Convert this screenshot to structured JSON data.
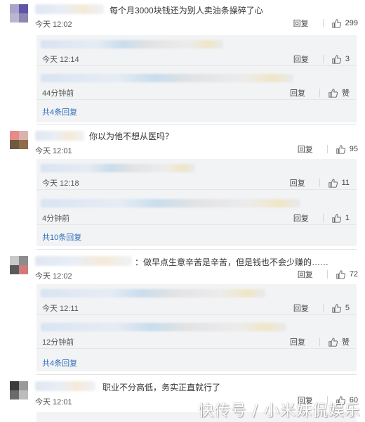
{
  "comments": [
    {
      "text": "每个月3000块钱还为别人卖油条操碎了心",
      "time": "今天 12:02",
      "reply_label": "回复",
      "likes": "299",
      "replies": [
        {
          "time": "今天 12:14",
          "reply_label": "回复",
          "likes": "3"
        },
        {
          "time": "44分钟前",
          "reply_label": "回复",
          "likes": "赞"
        }
      ],
      "more_label": "共4条回复"
    },
    {
      "text": "你以为他不想从医吗？",
      "time": "今天 12:01",
      "reply_label": "回复",
      "likes": "95",
      "replies": [
        {
          "time": "今天 12:18",
          "reply_label": "回复",
          "likes": "11"
        },
        {
          "time": "4分钟前",
          "reply_label": "回复",
          "likes": "1"
        }
      ],
      "more_label": "共10条回复"
    },
    {
      "text": "：做早点生意辛苦是辛苦，但是钱也不会少赚的……",
      "time": "今天 12:02",
      "reply_label": "回复",
      "likes": "72",
      "replies": [
        {
          "time": "今天 12:11",
          "reply_label": "回复",
          "likes": "5"
        },
        {
          "time": "12分钟前",
          "reply_label": "回复",
          "likes": "赞"
        }
      ],
      "more_label": "共4条回复"
    },
    {
      "text": "职业不分高低，务实正直就行了",
      "time": "今天 12:01",
      "reply_label": "回复",
      "likes": "60"
    }
  ],
  "watermark": "快传号 / 小米妹侃娱乐",
  "colors": {
    "link": "#2e6cb8",
    "reply_box_bg": "#f2f3f5",
    "text": "#333333"
  },
  "icons": {
    "like": "thumbs-up-icon"
  }
}
